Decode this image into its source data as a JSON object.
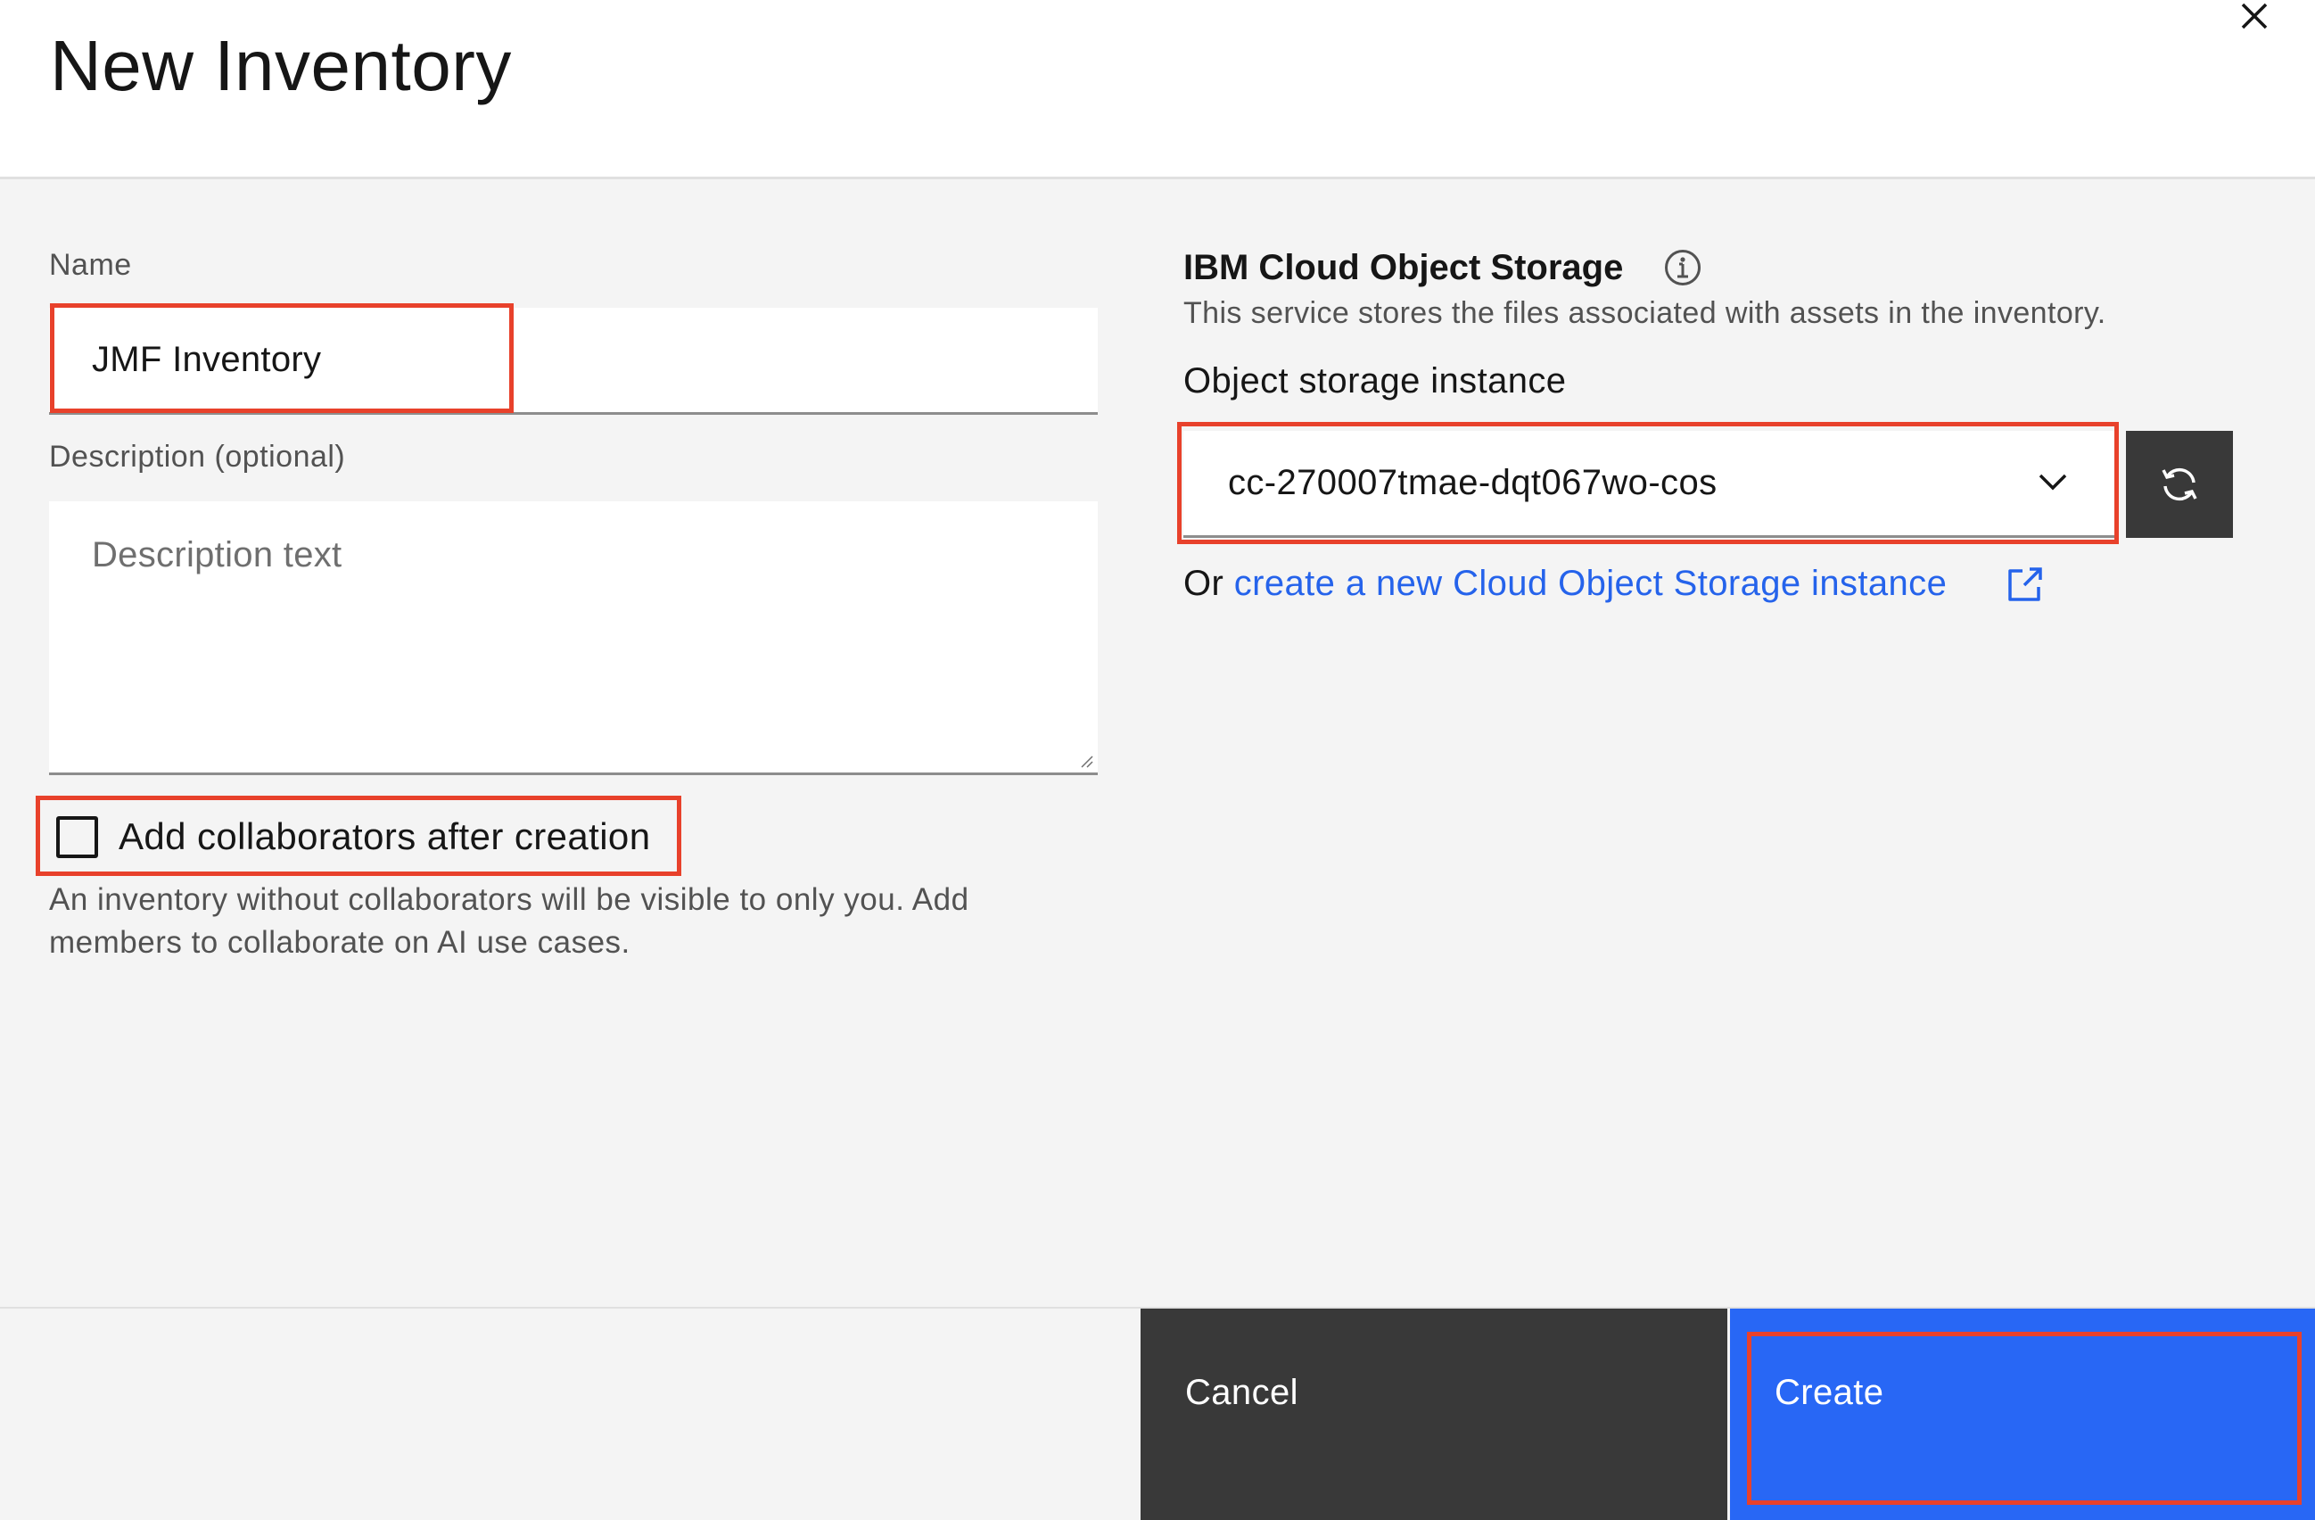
{
  "dialog": {
    "title": "New Inventory",
    "close_icon": "close-icon"
  },
  "form": {
    "name": {
      "label": "Name",
      "value": "JMF Inventory"
    },
    "description": {
      "label": "Description (optional)",
      "placeholder": "Description text",
      "value": ""
    },
    "collaborators": {
      "label": "Add collaborators after creation",
      "checked": false,
      "helper": "An inventory without collaborators will be visible to only you. Add members to collaborate on AI use cases."
    }
  },
  "storage": {
    "title": "IBM Cloud Object Storage",
    "info_icon": "info-icon",
    "description": "This service stores the files associated with assets in the inventory.",
    "instance_label": "Object storage instance",
    "selected_instance": "cc-270007tmae-dqt067wo-cos",
    "refresh_icon": "refresh-icon",
    "link_prefix": "Or ",
    "link_text": "create a new Cloud Object Storage instance",
    "external_link_icon": "launch-icon"
  },
  "footer": {
    "cancel_label": "Cancel",
    "create_label": "Create"
  },
  "colors": {
    "primary": "#2867f5",
    "secondary": "#393939",
    "link": "#2563eb",
    "annotation": "#e8412b",
    "background": "#f4f4f4"
  }
}
